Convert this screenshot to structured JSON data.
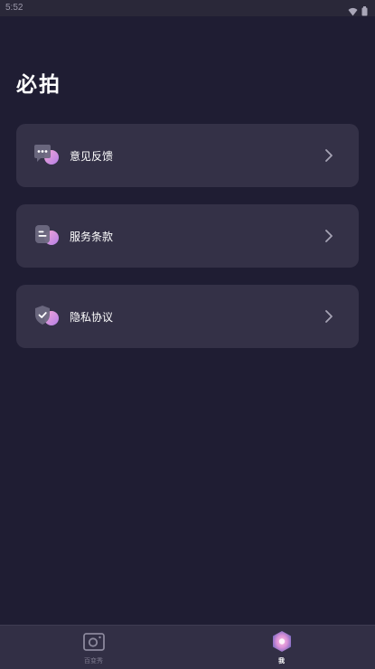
{
  "status_bar": {
    "time": "5:52",
    "icons": [
      "wifi-icon",
      "battery-icon"
    ]
  },
  "app": {
    "logo_text": "必拍"
  },
  "menu": {
    "items": [
      {
        "label": "意见反馈",
        "icon": "feedback-chat-icon"
      },
      {
        "label": "服务条款",
        "icon": "terms-document-icon"
      },
      {
        "label": "隐私协议",
        "icon": "privacy-shield-icon"
      }
    ]
  },
  "tab_bar": {
    "tabs": [
      {
        "label": "百变秀",
        "icon": "camera-icon",
        "active": false
      },
      {
        "label": "我",
        "icon": "profile-orb-icon",
        "active": true
      }
    ]
  },
  "colors": {
    "background": "#1f1d33",
    "card": "#343147",
    "tab_bar": "#322f45",
    "accent_pink": "#f09ad0",
    "accent_purple": "#b98be8",
    "inactive_text": "#7d7a8e"
  }
}
